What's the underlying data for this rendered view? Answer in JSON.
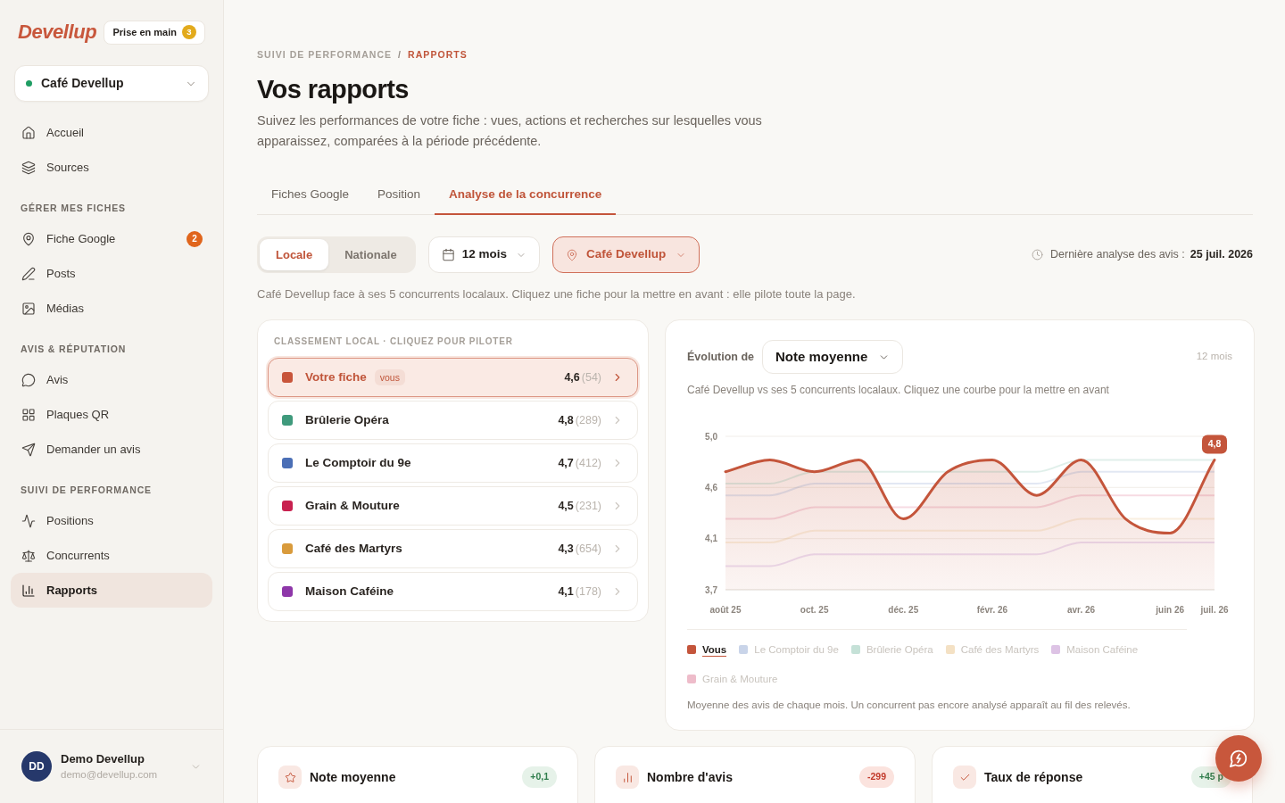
{
  "sidebar": {
    "logo": "Devellup",
    "onboarding": {
      "label": "Prise en main",
      "count": "3"
    },
    "business": {
      "name": "Café Devellup"
    },
    "sections": [
      {
        "items": [
          {
            "label": "Accueil",
            "selected": false
          },
          {
            "label": "Sources",
            "selected": false
          }
        ]
      },
      {
        "title": "GÉRER MES FICHES",
        "items": [
          {
            "label": "Fiche Google",
            "selected": false,
            "badge": "2"
          },
          {
            "label": "Posts",
            "selected": false
          },
          {
            "label": "Médias",
            "selected": false
          }
        ]
      },
      {
        "title": "AVIS & RÉPUTATION",
        "items": [
          {
            "label": "Avis",
            "selected": false
          },
          {
            "label": "Plaques QR",
            "selected": false
          },
          {
            "label": "Demander un avis",
            "selected": false
          }
        ]
      },
      {
        "title": "SUIVI DE PERFORMANCE",
        "items": [
          {
            "label": "Positions",
            "selected": false
          },
          {
            "label": "Concurrents",
            "selected": false
          },
          {
            "label": "Rapports",
            "selected": true
          }
        ]
      }
    ],
    "user": {
      "initials": "DD",
      "name": "Demo Devellup",
      "email": "demo@devellup.com"
    }
  },
  "breadcrumb": {
    "items": [
      "SUIVI DE PERFORMANCE",
      "RAPPORTS"
    ],
    "separator": "/"
  },
  "title": "Vos rapports",
  "description": "Suivez les performances de votre fiche : vues, actions et recherches sur lesquelles vous apparaissez, comparées à la période précédente.",
  "tabs": [
    {
      "label": "Fiches Google",
      "selected": false
    },
    {
      "label": "Position",
      "selected": false
    },
    {
      "label": "Analyse de la concurrence",
      "selected": true
    }
  ],
  "scope": [
    {
      "label": "Locale",
      "selected": true
    },
    {
      "label": "Nationale",
      "selected": false
    }
  ],
  "period_select": {
    "value": "12 mois"
  },
  "location_select": {
    "value": "Café Devellup"
  },
  "last_analysis": {
    "label": "Dernière analyse des avis :",
    "date": "25 juil. 2026"
  },
  "hint": "Café Devellup face à ses 5 concurrents localaux. Cliquez une fiche pour la mettre en avant : elle pilote toute la page.",
  "ranking": {
    "title": "CLASSEMENT LOCAL · CLIQUEZ POUR PILOTER",
    "rows": [
      {
        "name": "Votre fiche",
        "tag": "vous",
        "rating": "4,6",
        "count": "(54)",
        "color": "#c8553b",
        "selected": true
      },
      {
        "name": "Brûlerie Opéra",
        "rating": "4,8",
        "count": "(289)",
        "color": "#3f9a7c",
        "selected": false
      },
      {
        "name": "Le Comptoir du 9e",
        "rating": "4,7",
        "count": "(412)",
        "color": "#4b6fb6",
        "selected": false
      },
      {
        "name": "Grain & Mouture",
        "rating": "4,5",
        "count": "(231)",
        "color": "#c8214f",
        "selected": false
      },
      {
        "name": "Café des Martyrs",
        "rating": "4,3",
        "count": "(654)",
        "color": "#d99b3c",
        "selected": false
      },
      {
        "name": "Maison Caféine",
        "rating": "4,1",
        "count": "(178)",
        "color": "#8e37a9",
        "selected": false
      }
    ]
  },
  "evolution": {
    "label": "Évolution de",
    "metric": "Note moyenne",
    "period": "12 mois",
    "subtitle": "Café Devellup vs ses 5 concurrents localaux. Cliquez une courbe pour la mettre en avant",
    "chart_data": {
      "type": "line",
      "categories": [
        "août 25",
        null,
        "oct. 25",
        null,
        "déc. 25",
        null,
        "févr. 26",
        null,
        "avr. 26",
        null,
        "juin 26",
        "juil. 26"
      ],
      "ylim": [
        3.7,
        5.0
      ],
      "yticks": [
        {
          "value": 5.0,
          "label": "5,0"
        },
        {
          "value": 4.567,
          "label": "4,6"
        },
        {
          "value": 4.133,
          "label": "4,1"
        },
        {
          "value": 3.7,
          "label": "3,7"
        }
      ],
      "series": [
        {
          "name": "Vous",
          "type": "area",
          "color": "#c4553b",
          "values": [
            4.7,
            4.8,
            4.7,
            4.8,
            4.3,
            4.7,
            4.8,
            4.5,
            4.8,
            4.3,
            4.18,
            4.8
          ]
        },
        {
          "name": "Le Comptoir du 9e",
          "type": "line",
          "color": "#4b6fb6",
          "values": [
            4.5,
            4.5,
            4.6,
            4.6,
            4.6,
            4.6,
            4.6,
            4.6,
            4.7,
            4.7,
            4.7,
            4.7
          ]
        },
        {
          "name": "Brûlerie Opéra",
          "type": "line",
          "color": "#3f9a7c",
          "values": [
            4.6,
            4.6,
            4.7,
            4.7,
            4.7,
            4.7,
            4.7,
            4.7,
            4.8,
            4.8,
            4.8,
            4.8
          ]
        },
        {
          "name": "Café des Martyrs",
          "type": "line",
          "color": "#d99b3c",
          "values": [
            4.1,
            4.1,
            4.2,
            4.2,
            4.2,
            4.2,
            4.2,
            4.2,
            4.3,
            4.3,
            4.3,
            4.3
          ]
        },
        {
          "name": "Maison Caféine",
          "type": "line",
          "color": "#8e37a9",
          "values": [
            3.9,
            3.9,
            4.0,
            4.0,
            4.0,
            4.0,
            4.0,
            4.0,
            4.1,
            4.1,
            4.1,
            4.1
          ]
        },
        {
          "name": "Grain & Mouture",
          "type": "line",
          "color": "#c8214f",
          "values": [
            4.3,
            4.3,
            4.4,
            4.4,
            4.4,
            4.4,
            4.4,
            4.4,
            4.5,
            4.5,
            4.5,
            4.5
          ]
        }
      ],
      "annotations": [
        {
          "x": "juil. 26",
          "y": 4.8,
          "text": "4,8"
        }
      ]
    },
    "legend": [
      {
        "selected": true
      },
      {
        "selected": false
      },
      {
        "selected": false
      },
      {
        "selected": false
      },
      {
        "selected": false
      },
      {
        "selected": false
      }
    ],
    "note": "Moyenne des avis de chaque mois. Un concurrent pas encore analysé apparaît au fil des relevés."
  },
  "stat_cards": [
    {
      "kind": "rating",
      "title": "Note moyenne",
      "delta": "+0,1",
      "positive": true
    },
    {
      "kind": "count",
      "title": "Nombre d'avis",
      "delta": "-299",
      "positive": false
    },
    {
      "kind": "response",
      "title": "Taux de réponse",
      "delta": "+45 p",
      "positive": true
    }
  ]
}
